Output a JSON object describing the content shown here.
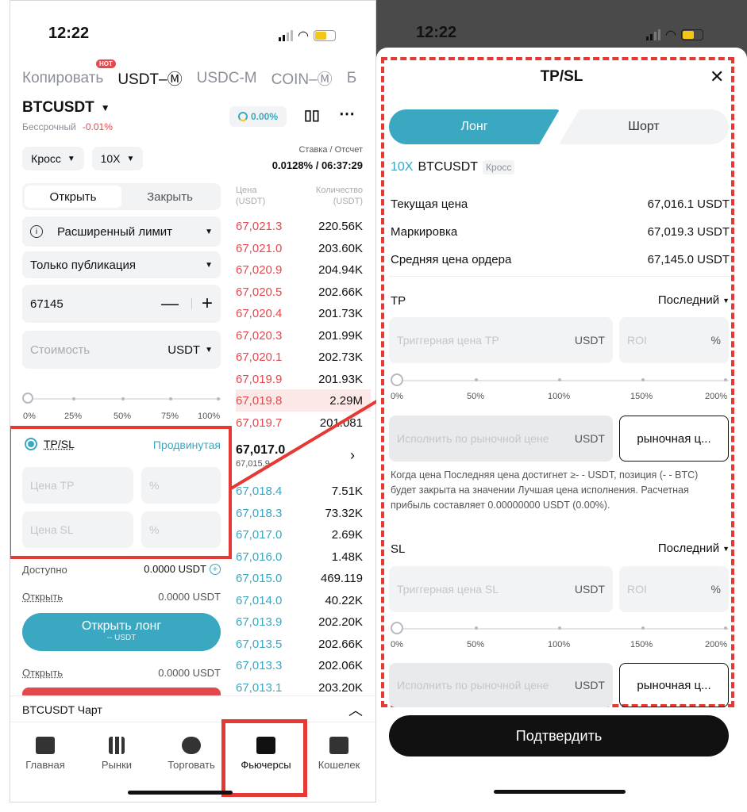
{
  "left": {
    "status_time": "12:22",
    "tabs": {
      "hot_badge": "HOT",
      "copy": "Копировать",
      "usdt_m": "USDT–Ⓜ",
      "usdc_m": "USDC-M",
      "coin_m": "COIN–Ⓜ",
      "more": "Б"
    },
    "symbol": "BTCUSDT",
    "contract_type": "Бессрочный",
    "change": "-0.01%",
    "funding_pct": "0.00%",
    "funding_label": "Ставка / Отсчет",
    "funding_value": "0.0128% / 06:37:29",
    "margin_mode": "Кросс",
    "leverage": "10X",
    "open_tab": "Открыть",
    "close_tab": "Закрыть",
    "order_type": "Расширенный лимит",
    "time_in_force": "Только публикация",
    "price_value": "67145",
    "cost_placeholder": "Стоимость",
    "cost_unit": "USDT",
    "slider_ticks": [
      "0%",
      "25%",
      "50%",
      "75%",
      "100%"
    ],
    "tpsl_label": "TP/SL",
    "advanced_link": "Продвинутая",
    "tp_price_placeholder": "Цена TP",
    "sl_price_placeholder": "Цена SL",
    "pct_placeholder": "%",
    "available_label": "Доступно",
    "available_value": "0.0000 USDT",
    "open_label": "Открыть",
    "open_value": "0.0000 USDT",
    "open_long_btn": "Открыть лонг",
    "open_long_sub": "-- USDT",
    "open_label2": "Открыть",
    "open_value2": "0.0000 USDT",
    "ob_header_price": "Цена (USDT)",
    "ob_header_qty": "Количество (USDT)",
    "asks": [
      [
        "67,021.3",
        "220.56K"
      ],
      [
        "67,021.0",
        "203.60K"
      ],
      [
        "67,020.9",
        "204.94K"
      ],
      [
        "67,020.5",
        "202.66K"
      ],
      [
        "67,020.4",
        "201.73K"
      ],
      [
        "67,020.3",
        "201.99K"
      ],
      [
        "67,020.1",
        "202.73K"
      ],
      [
        "67,019.9",
        "201.93K"
      ],
      [
        "67,019.8",
        "2.29M"
      ],
      [
        "67,019.7",
        "201.081"
      ]
    ],
    "mid_price": "67,017.0",
    "mid_sub": "67,015.9",
    "bids": [
      [
        "67,018.4",
        "7.51K"
      ],
      [
        "67,018.3",
        "73.32K"
      ],
      [
        "67,017.0",
        "2.69K"
      ],
      [
        "67,016.0",
        "1.48K"
      ],
      [
        "67,015.0",
        "469.119"
      ],
      [
        "67,014.0",
        "40.22K"
      ],
      [
        "67,013.9",
        "202.20K"
      ],
      [
        "67,013.5",
        "202.66K"
      ],
      [
        "67,013.3",
        "202.06K"
      ],
      [
        "67,013.1",
        "203.20K"
      ]
    ],
    "chart_bar": "BTCUSDT  Чарт",
    "nav": [
      "Главная",
      "Рынки",
      "Торговать",
      "Фьючерсы",
      "Кошелек"
    ]
  },
  "right": {
    "status_time": "12:22",
    "title": "TP/SL",
    "long_tab": "Лонг",
    "short_tab": "Шорт",
    "leverage": "10X",
    "symbol": "BTCUSDT",
    "mode_badge": "Кросс",
    "rows": [
      [
        "Текущая цена",
        "67,016.1 USDT"
      ],
      [
        "Маркировка",
        "67,019.3 USDT"
      ],
      [
        "Средняя цена ордера",
        "67,145.0 USDT"
      ]
    ],
    "tp_label": "TP",
    "sl_label": "SL",
    "last_select": "Последний",
    "tp_trigger_placeholder": "Триггерная цена TP",
    "sl_trigger_placeholder": "Триггерная цена SL",
    "unit": "USDT",
    "roi": "ROI",
    "pct": "%",
    "slider_ticks": [
      "0%",
      "50%",
      "100%",
      "150%",
      "200%"
    ],
    "market_placeholder": "Исполнить по рыночной цене",
    "market_btn": "рыночная ц...",
    "note": "Когда цена Последняя цена достигнет ≥- - USDT, позиция (- - BTC) будет закрыта на значении Лучшая цена исполнения. Расчетная прибыль составляет 0.00000000 USDT (0.00%).",
    "confirm": "Подтвердить"
  },
  "colors": {
    "accent": "#3aa8c1",
    "ask": "#e5484d",
    "bid": "#3aa8c1",
    "highlight": "#e53935",
    "confirm": "#111111"
  }
}
